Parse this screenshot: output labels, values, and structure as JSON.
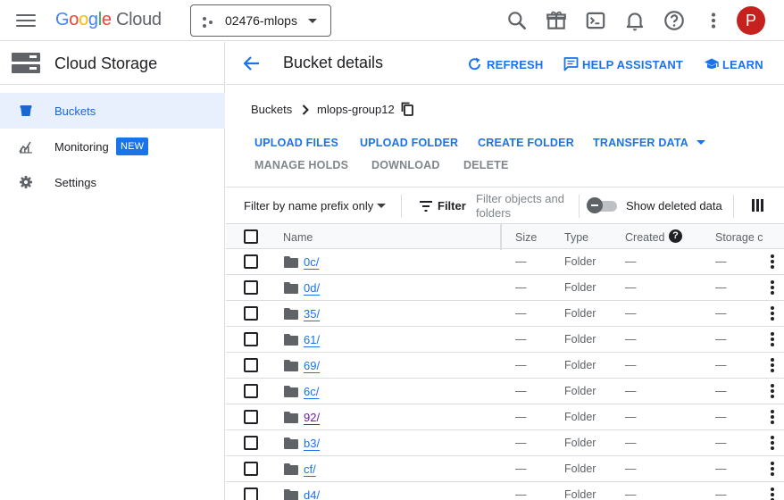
{
  "topbar": {
    "logo": {
      "g1": "G",
      "g2": "o",
      "g3": "o",
      "g4": "g",
      "g5": "l",
      "g6": "e",
      "cloud": " Cloud"
    },
    "project": "02476-mlops",
    "icons": [
      "search-icon",
      "gift-icon",
      "cloud-shell-icon",
      "notifications-icon",
      "help-icon",
      "more-vert-icon"
    ],
    "avatar_initial": "P",
    "avatar_color": "#c5221f"
  },
  "sidebar": {
    "title": "Cloud Storage",
    "items": [
      {
        "label": "Buckets",
        "icon": "bucket-icon",
        "active": true
      },
      {
        "label": "Monitoring",
        "icon": "monitoring-icon",
        "badge": "NEW"
      },
      {
        "label": "Settings",
        "icon": "settings-icon"
      }
    ]
  },
  "header": {
    "title": "Bucket details",
    "refresh": "REFRESH",
    "help_assistant": "HELP ASSISTANT",
    "learn": "LEARN"
  },
  "breadcrumb": {
    "root": "Buckets",
    "current": "mlops-group12"
  },
  "actions": {
    "upload_files": "UPLOAD FILES",
    "upload_folder": "UPLOAD FOLDER",
    "create_folder": "CREATE FOLDER",
    "transfer_data": "TRANSFER DATA",
    "manage_holds": "MANAGE HOLDS",
    "download": "DOWNLOAD",
    "delete": "DELETE"
  },
  "filter": {
    "prefix_select": "Filter by name prefix only",
    "filter_label": "Filter",
    "placeholder_line1": "Filter objects and",
    "placeholder_line2": "folders",
    "show_deleted": "Show deleted data"
  },
  "table": {
    "columns": {
      "name": "Name",
      "size": "Size",
      "type": "Type",
      "created": "Created",
      "storage": "Storage c"
    },
    "rows": [
      {
        "name": "0c/",
        "size": "—",
        "type": "Folder",
        "created": "—",
        "storage": "—"
      },
      {
        "name": "0d/",
        "size": "—",
        "type": "Folder",
        "created": "—",
        "storage": "—"
      },
      {
        "name": "35/",
        "size": "—",
        "type": "Folder",
        "created": "—",
        "storage": "—"
      },
      {
        "name": "61/",
        "size": "—",
        "type": "Folder",
        "created": "—",
        "storage": "—"
      },
      {
        "name": "69/",
        "size": "—",
        "type": "Folder",
        "created": "—",
        "storage": "—"
      },
      {
        "name": "6c/",
        "size": "—",
        "type": "Folder",
        "created": "—",
        "storage": "—"
      },
      {
        "name": "92/",
        "size": "—",
        "type": "Folder",
        "created": "—",
        "storage": "—",
        "visited": true
      },
      {
        "name": "b3/",
        "size": "—",
        "type": "Folder",
        "created": "—",
        "storage": "—"
      },
      {
        "name": "cf/",
        "size": "—",
        "type": "Folder",
        "created": "—",
        "storage": "—"
      },
      {
        "name": "d4/",
        "size": "—",
        "type": "Folder",
        "created": "—",
        "storage": "—"
      }
    ]
  },
  "colors": {
    "accent": "#1a73e8",
    "active_nav_bg": "#e8f0fe",
    "visited_link": "#681da8"
  }
}
